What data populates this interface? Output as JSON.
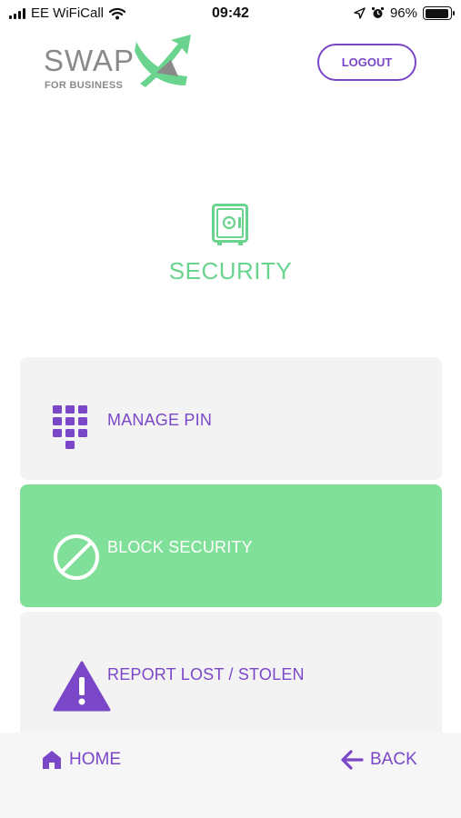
{
  "status_bar": {
    "carrier": "EE WiFiCall",
    "time": "09:42",
    "battery_percent": "96%",
    "battery_level": 0.96,
    "icons": [
      "signal-icon",
      "wifi-icon",
      "location-arrow-icon",
      "alarm-icon",
      "battery-icon"
    ]
  },
  "header": {
    "logo_text": "SWAP",
    "logo_subtext": "FOR BUSINESS",
    "logout_label": "LOGOUT"
  },
  "page": {
    "title": "SECURITY",
    "title_icon": "safe-icon"
  },
  "menu": [
    {
      "label": "MANAGE PIN",
      "icon": "keypad-icon",
      "selected": false
    },
    {
      "label": "BLOCK SECURITY",
      "icon": "block-icon",
      "selected": true
    },
    {
      "label": "REPORT LOST / STOLEN",
      "icon": "warning-icon",
      "selected": false
    }
  ],
  "bottom_nav": {
    "home_label": "HOME",
    "back_label": "BACK"
  },
  "colors": {
    "accent_purple": "#7b47c9",
    "brand_green": "#6ad38e",
    "selected_card": "#80df98",
    "card_background": "#f3f3f4"
  }
}
